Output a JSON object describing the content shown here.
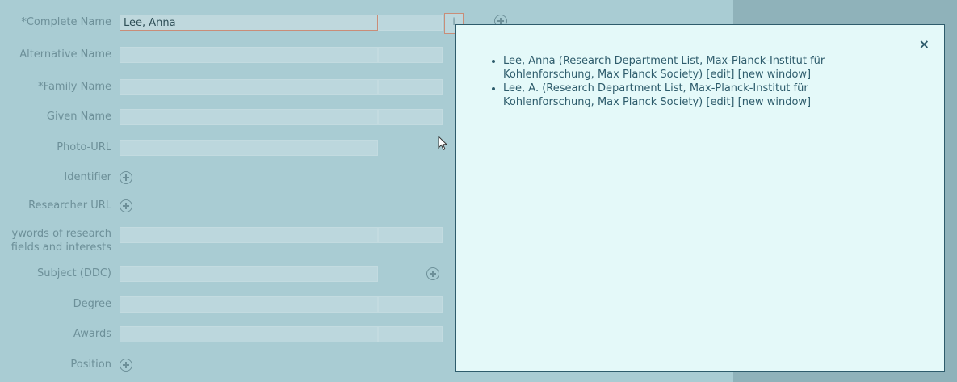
{
  "form": {
    "rows": [
      {
        "label": "*Complete Name",
        "value": "Lee, Anna"
      },
      {
        "label": "Alternative Name"
      },
      {
        "label": "*Family Name"
      },
      {
        "label": "Given Name"
      },
      {
        "label": "Photo-URL"
      },
      {
        "label": "Identifier"
      },
      {
        "label": "Researcher URL"
      },
      {
        "label_line1": "ywords of research",
        "label_line2": "fields and interests"
      },
      {
        "label": "Subject (DDC)"
      },
      {
        "label": "Degree"
      },
      {
        "label": "Awards"
      },
      {
        "label": "Position"
      }
    ],
    "info_button_label": "i"
  },
  "popup": {
    "close_label": "×",
    "items": [
      {
        "text": "Lee, Anna (Research Department List, Max-Planck-Institut für Kohlenforschung, Max Planck Society)",
        "edit": "[edit]",
        "new_window": "[new window]"
      },
      {
        "text": "Lee, A. (Research Department List, Max-Planck-Institut für Kohlenforschung, Max Planck Society)",
        "edit": "[edit]",
        "new_window": "[new window]"
      }
    ]
  }
}
